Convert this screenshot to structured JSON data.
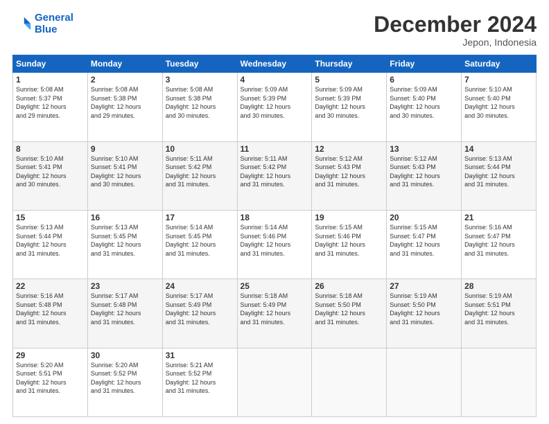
{
  "logo": {
    "line1": "General",
    "line2": "Blue"
  },
  "title": "December 2024",
  "subtitle": "Jepon, Indonesia",
  "days_header": [
    "Sunday",
    "Monday",
    "Tuesday",
    "Wednesday",
    "Thursday",
    "Friday",
    "Saturday"
  ],
  "weeks": [
    [
      {
        "day": "1",
        "rise": "5:08 AM",
        "set": "5:37 PM",
        "daylight": "12 hours and 29 minutes."
      },
      {
        "day": "2",
        "rise": "5:08 AM",
        "set": "5:38 PM",
        "daylight": "12 hours and 29 minutes."
      },
      {
        "day": "3",
        "rise": "5:08 AM",
        "set": "5:38 PM",
        "daylight": "12 hours and 30 minutes."
      },
      {
        "day": "4",
        "rise": "5:09 AM",
        "set": "5:39 PM",
        "daylight": "12 hours and 30 minutes."
      },
      {
        "day": "5",
        "rise": "5:09 AM",
        "set": "5:39 PM",
        "daylight": "12 hours and 30 minutes."
      },
      {
        "day": "6",
        "rise": "5:09 AM",
        "set": "5:40 PM",
        "daylight": "12 hours and 30 minutes."
      },
      {
        "day": "7",
        "rise": "5:10 AM",
        "set": "5:40 PM",
        "daylight": "12 hours and 30 minutes."
      }
    ],
    [
      {
        "day": "8",
        "rise": "5:10 AM",
        "set": "5:41 PM",
        "daylight": "12 hours and 30 minutes."
      },
      {
        "day": "9",
        "rise": "5:10 AM",
        "set": "5:41 PM",
        "daylight": "12 hours and 30 minutes."
      },
      {
        "day": "10",
        "rise": "5:11 AM",
        "set": "5:42 PM",
        "daylight": "12 hours and 31 minutes."
      },
      {
        "day": "11",
        "rise": "5:11 AM",
        "set": "5:42 PM",
        "daylight": "12 hours and 31 minutes."
      },
      {
        "day": "12",
        "rise": "5:12 AM",
        "set": "5:43 PM",
        "daylight": "12 hours and 31 minutes."
      },
      {
        "day": "13",
        "rise": "5:12 AM",
        "set": "5:43 PM",
        "daylight": "12 hours and 31 minutes."
      },
      {
        "day": "14",
        "rise": "5:13 AM",
        "set": "5:44 PM",
        "daylight": "12 hours and 31 minutes."
      }
    ],
    [
      {
        "day": "15",
        "rise": "5:13 AM",
        "set": "5:44 PM",
        "daylight": "12 hours and 31 minutes."
      },
      {
        "day": "16",
        "rise": "5:13 AM",
        "set": "5:45 PM",
        "daylight": "12 hours and 31 minutes."
      },
      {
        "day": "17",
        "rise": "5:14 AM",
        "set": "5:45 PM",
        "daylight": "12 hours and 31 minutes."
      },
      {
        "day": "18",
        "rise": "5:14 AM",
        "set": "5:46 PM",
        "daylight": "12 hours and 31 minutes."
      },
      {
        "day": "19",
        "rise": "5:15 AM",
        "set": "5:46 PM",
        "daylight": "12 hours and 31 minutes."
      },
      {
        "day": "20",
        "rise": "5:15 AM",
        "set": "5:47 PM",
        "daylight": "12 hours and 31 minutes."
      },
      {
        "day": "21",
        "rise": "5:16 AM",
        "set": "5:47 PM",
        "daylight": "12 hours and 31 minutes."
      }
    ],
    [
      {
        "day": "22",
        "rise": "5:16 AM",
        "set": "5:48 PM",
        "daylight": "12 hours and 31 minutes."
      },
      {
        "day": "23",
        "rise": "5:17 AM",
        "set": "5:48 PM",
        "daylight": "12 hours and 31 minutes."
      },
      {
        "day": "24",
        "rise": "5:17 AM",
        "set": "5:49 PM",
        "daylight": "12 hours and 31 minutes."
      },
      {
        "day": "25",
        "rise": "5:18 AM",
        "set": "5:49 PM",
        "daylight": "12 hours and 31 minutes."
      },
      {
        "day": "26",
        "rise": "5:18 AM",
        "set": "5:50 PM",
        "daylight": "12 hours and 31 minutes."
      },
      {
        "day": "27",
        "rise": "5:19 AM",
        "set": "5:50 PM",
        "daylight": "12 hours and 31 minutes."
      },
      {
        "day": "28",
        "rise": "5:19 AM",
        "set": "5:51 PM",
        "daylight": "12 hours and 31 minutes."
      }
    ],
    [
      {
        "day": "29",
        "rise": "5:20 AM",
        "set": "5:51 PM",
        "daylight": "12 hours and 31 minutes."
      },
      {
        "day": "30",
        "rise": "5:20 AM",
        "set": "5:52 PM",
        "daylight": "12 hours and 31 minutes."
      },
      {
        "day": "31",
        "rise": "5:21 AM",
        "set": "5:52 PM",
        "daylight": "12 hours and 31 minutes."
      },
      null,
      null,
      null,
      null
    ]
  ]
}
